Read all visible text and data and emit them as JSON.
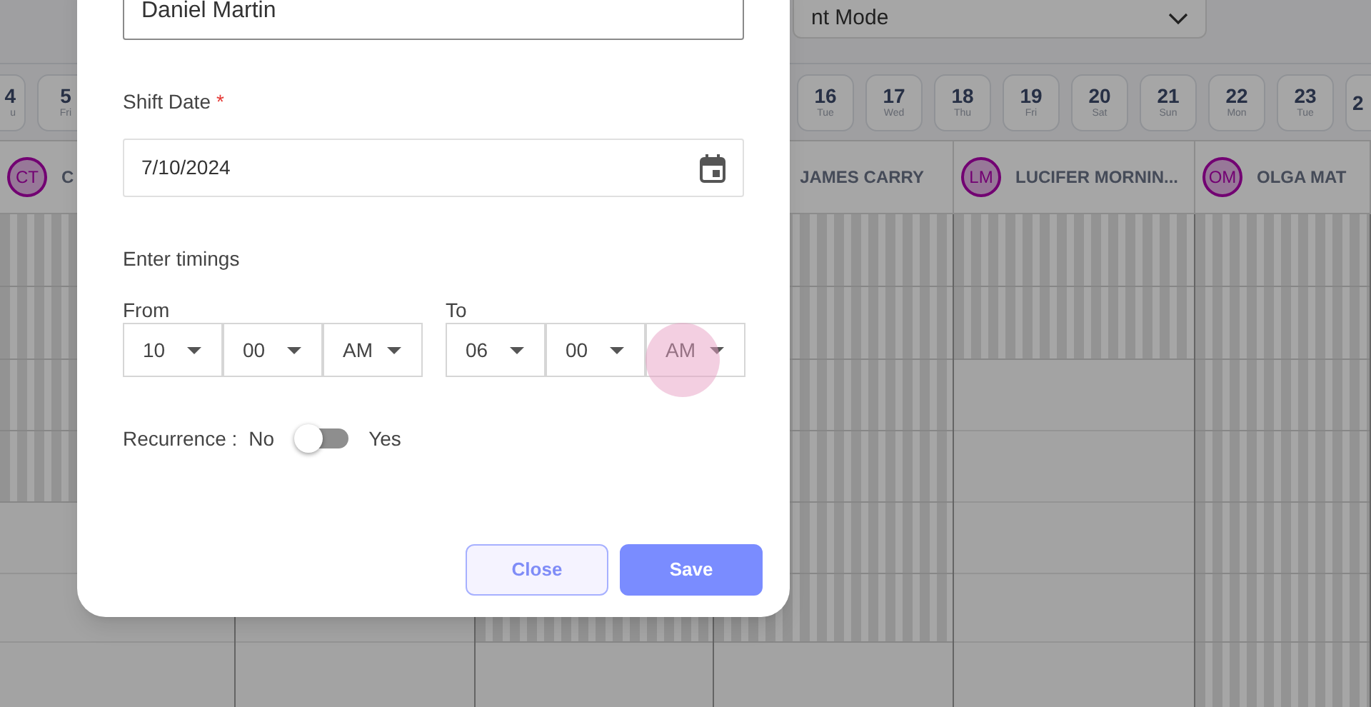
{
  "mode_select": {
    "value": "nt Mode"
  },
  "date_chips_left": [
    {
      "day": "4",
      "weekday": "u"
    },
    {
      "day": "5",
      "weekday": "Fri"
    }
  ],
  "date_chips_right": [
    {
      "day": "16",
      "weekday": "Tue"
    },
    {
      "day": "17",
      "weekday": "Wed"
    },
    {
      "day": "18",
      "weekday": "Thu"
    },
    {
      "day": "19",
      "weekday": "Fri"
    },
    {
      "day": "20",
      "weekday": "Sat"
    },
    {
      "day": "21",
      "weekday": "Sun"
    },
    {
      "day": "22",
      "weekday": "Mon"
    },
    {
      "day": "23",
      "weekday": "Tue"
    },
    {
      "day": "2"
    }
  ],
  "staff_columns": [
    {
      "initials": "CT",
      "name": "C"
    },
    {
      "name": "JAMES CARRY"
    },
    {
      "initials": "LM",
      "name": "LUCIFER MORNIN..."
    },
    {
      "initials": "OM",
      "name": "OLGA MAT"
    }
  ],
  "dialog": {
    "employee_field": {
      "value": "Daniel Martin"
    },
    "shift_date": {
      "label": "Shift Date",
      "required_mark": "*",
      "value": "7/10/2024"
    },
    "timings": {
      "label": "Enter timings",
      "from": {
        "label": "From",
        "selects": [
          "10",
          "00",
          "AM"
        ]
      },
      "to": {
        "label": "To",
        "selects": [
          "06",
          "00",
          "AM"
        ]
      }
    },
    "recurrence": {
      "label": "Recurrence :",
      "off_label": "No",
      "on_label": "Yes",
      "on": false
    },
    "buttons": [
      {
        "label": "Close",
        "kind": "secondary"
      },
      {
        "label": "Save",
        "kind": "primary"
      }
    ]
  }
}
